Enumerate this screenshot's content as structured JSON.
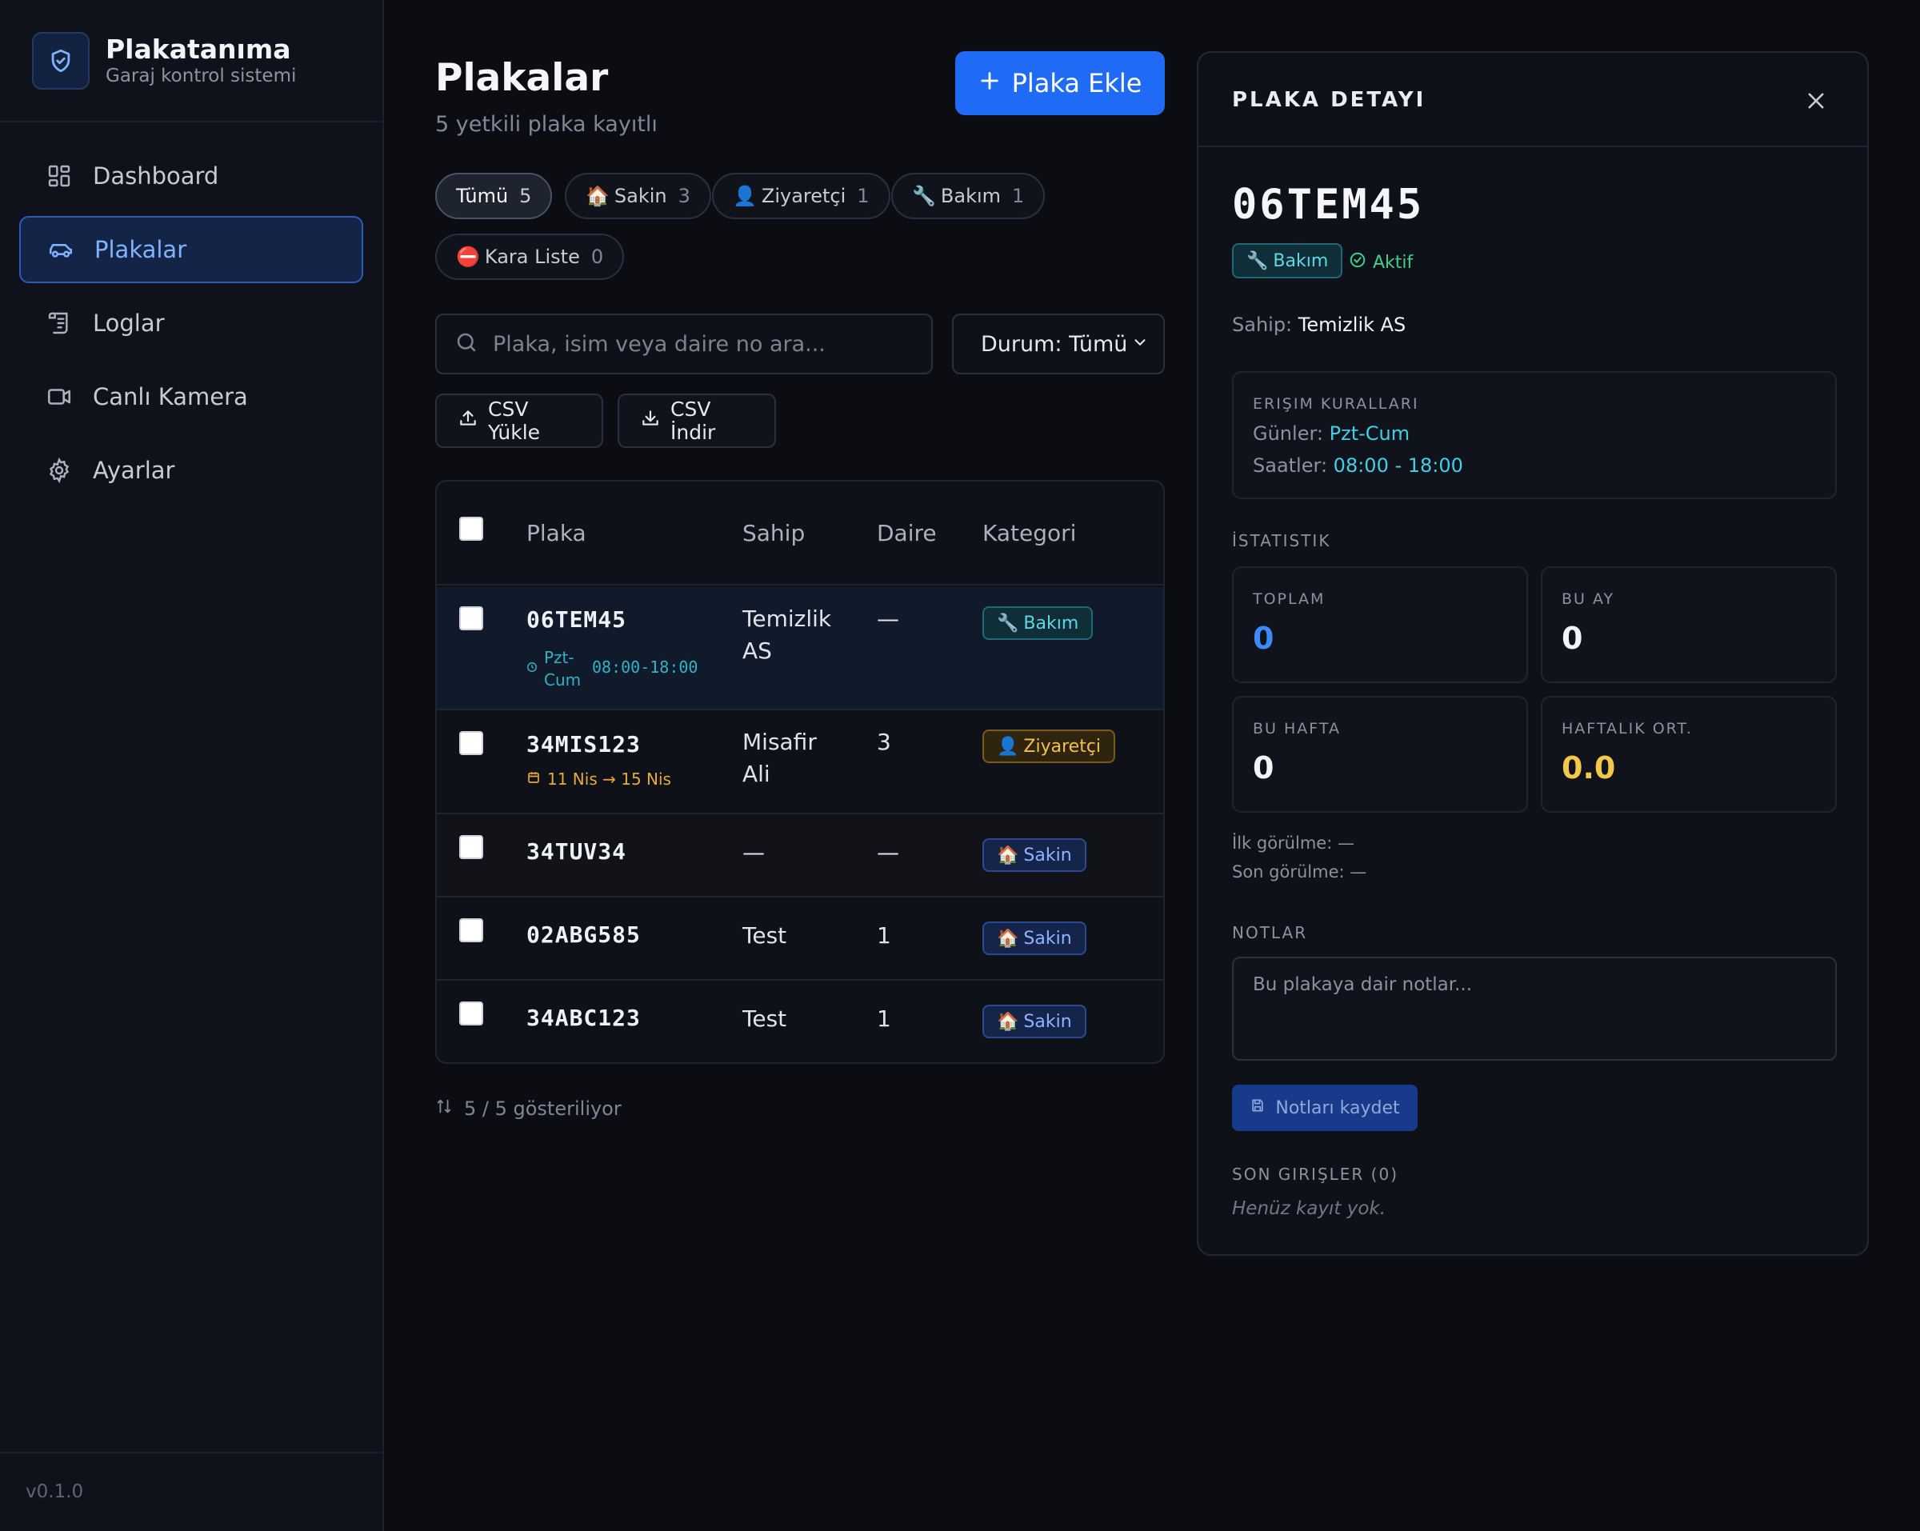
{
  "brand": {
    "title": "Plakatanıma",
    "subtitle": "Garaj kontrol sistemi"
  },
  "nav": {
    "items": [
      {
        "label": "Dashboard",
        "icon": "dashboard-icon"
      },
      {
        "label": "Plakalar",
        "icon": "car-icon",
        "active": true
      },
      {
        "label": "Loglar",
        "icon": "scroll-icon"
      },
      {
        "label": "Canlı Kamera",
        "icon": "video-icon"
      },
      {
        "label": "Ayarlar",
        "icon": "gear-icon"
      }
    ]
  },
  "version": "v0.1.0",
  "header": {
    "title": "Plakalar",
    "subtitle": "5 yetkili plaka kayıtlı",
    "add_label": "Plaka Ekle"
  },
  "filters": [
    {
      "label": "Tümü",
      "count": "5",
      "emoji": ""
    },
    {
      "label": "Sakin",
      "count": "3",
      "emoji": "🏠"
    },
    {
      "label": "Ziyaretçi",
      "count": "1",
      "emoji": "👤"
    },
    {
      "label": "Bakım",
      "count": "1",
      "emoji": "🔧"
    },
    {
      "label": "Kara Liste",
      "count": "0",
      "emoji": "⛔"
    }
  ],
  "search": {
    "placeholder": "Plaka, isim veya daire no ara...",
    "value": ""
  },
  "status_select": {
    "value": "Durum: Tümü"
  },
  "actions": {
    "csv_upload": "CSV Yükle",
    "csv_download": "CSV İndir"
  },
  "table": {
    "columns": [
      "Plaka",
      "Sahip",
      "Daire",
      "Kategori"
    ],
    "rows": [
      {
        "plate": "06TEM45",
        "owner1": "Temizlik",
        "owner2": "AS",
        "unit": "—",
        "category": "Bakım",
        "emoji": "🔧",
        "sub_days1": "Pzt-",
        "sub_days2": "Cum",
        "sub_time": "08:00-18:00"
      },
      {
        "plate": "34MIS123",
        "owner1": "Misafir",
        "owner2": "Ali",
        "unit": "3",
        "category": "Ziyaretçi",
        "emoji": "👤",
        "sub_date": "11 Nis → 15 Nis"
      },
      {
        "plate": "34TUV34",
        "owner1": "—",
        "owner2": "",
        "unit": "—",
        "category": "Sakin",
        "emoji": "🏠"
      },
      {
        "plate": "02ABG585",
        "owner1": "Test",
        "owner2": "",
        "unit": "1",
        "category": "Sakin",
        "emoji": "🏠"
      },
      {
        "plate": "34ABC123",
        "owner1": "Test",
        "owner2": "",
        "unit": "1",
        "category": "Sakin",
        "emoji": "🏠"
      }
    ]
  },
  "footer": {
    "count_text": "5 / 5 gösteriliyor"
  },
  "detail": {
    "title": "PLAKA DETAYI",
    "plate": "06TEM45",
    "category_badge": "Bakım",
    "status": "Aktif",
    "owner_label": "Sahip:",
    "owner": "Temizlik AS",
    "access_title": "ERIŞIM KURALLARI",
    "days_label": "Günler:",
    "days": "Pzt-Cum",
    "hours_label": "Saatler:",
    "hours": "08:00 - 18:00",
    "stats_title": "İSTATISTIK",
    "stats": [
      {
        "label": "TOPLAM",
        "value": "0",
        "color": "#3b8bff"
      },
      {
        "label": "BU AY",
        "value": "0",
        "color": "#f2f4f8"
      },
      {
        "label": "BU HAFTA",
        "value": "0",
        "color": "#f2f4f8"
      },
      {
        "label": "HAFTALIK ORT.",
        "value": "0.0",
        "color": "#f2c84a"
      }
    ],
    "first_seen": "İlk görülme: —",
    "last_seen": "Son görülme: —",
    "notes_title": "NOTLAR",
    "notes_placeholder": "Bu plakaya dair notlar...",
    "save_label": "Notları kaydet",
    "recent_title": "SON GIRIŞLER (0)",
    "recent_empty": "Henüz kayıt yok."
  },
  "colors": {
    "accent": "#1f6bf5",
    "background": "#0b0d13",
    "bakim": "#5fd6e6",
    "ziyaretci": "#f2c14e",
    "sakin": "#8cb4ff",
    "active_status": "#3ecf8e"
  }
}
